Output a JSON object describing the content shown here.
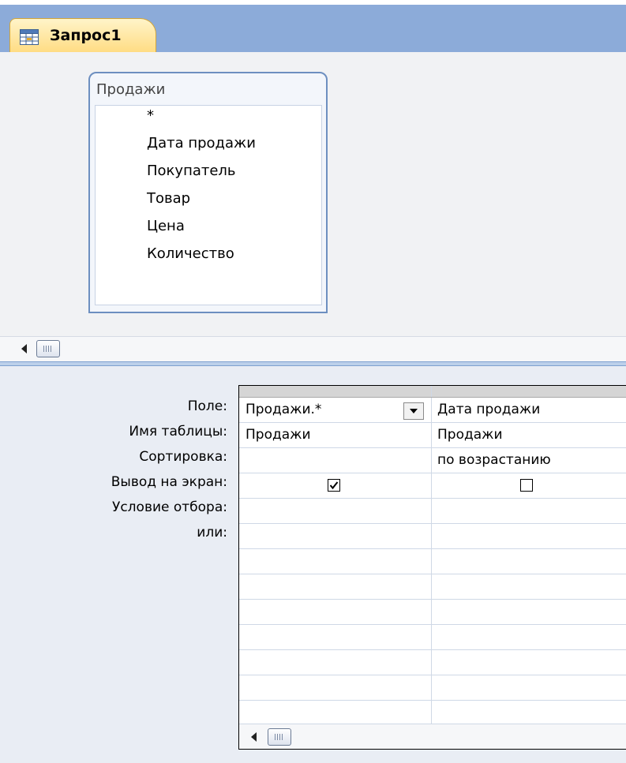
{
  "tab": {
    "title": "Запрос1",
    "icon": "query-icon"
  },
  "table": {
    "name": "Продажи",
    "fields": [
      "*",
      "Дата продажи",
      "Покупатель",
      "Товар",
      "Цена",
      "Количество"
    ]
  },
  "grid": {
    "row_labels": [
      "Поле:",
      "Имя таблицы:",
      "Сортировка:",
      "Вывод на экран:",
      "Условие отбора:",
      "или:"
    ],
    "columns": [
      {
        "field": "Продажи.*",
        "table": "Продажи",
        "sort": "",
        "show": true
      },
      {
        "field": "Дата продажи",
        "table": "Продажи",
        "sort": "по возрастанию",
        "show": false
      }
    ]
  },
  "colors": {
    "tab_bar": "#8cabd9",
    "active_tab": "#ffd97a",
    "table_border": "#6d8fc0"
  }
}
